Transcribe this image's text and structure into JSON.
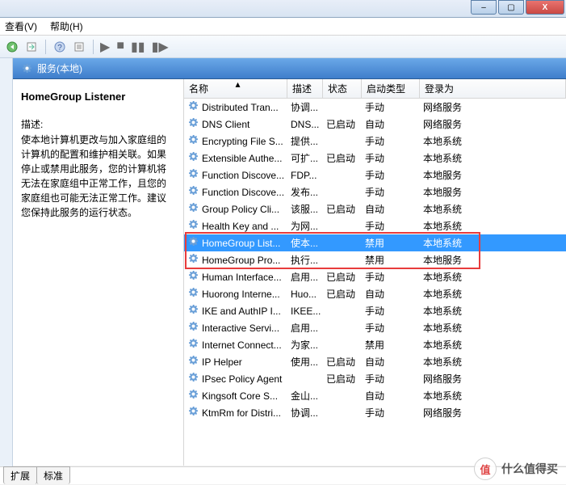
{
  "window": {
    "min": "–",
    "max": "▢",
    "close": "X"
  },
  "menu": {
    "view": "查看(V)",
    "help": "帮助(H)"
  },
  "nav": {
    "label": "服务(本地)"
  },
  "info": {
    "title": "HomeGroup Listener",
    "desc_label": "描述:",
    "description": "使本地计算机更改与加入家庭组的计算机的配置和维护相关联。如果停止或禁用此服务，您的计算机将无法在家庭组中正常工作，且您的家庭组也可能无法正常工作。建议您保持此服务的运行状态。"
  },
  "columns": {
    "name": "名称",
    "desc": "描述",
    "state": "状态",
    "start": "启动类型",
    "login": "登录为"
  },
  "services": [
    {
      "name": "Distributed Tran...",
      "desc": "协调...",
      "state": "",
      "start": "手动",
      "login": "网络服务"
    },
    {
      "name": "DNS Client",
      "desc": "DNS...",
      "state": "已启动",
      "start": "自动",
      "login": "网络服务"
    },
    {
      "name": "Encrypting File S...",
      "desc": "提供...",
      "state": "",
      "start": "手动",
      "login": "本地系统"
    },
    {
      "name": "Extensible Authe...",
      "desc": "可扩...",
      "state": "已启动",
      "start": "手动",
      "login": "本地系统"
    },
    {
      "name": "Function Discove...",
      "desc": "FDP...",
      "state": "",
      "start": "手动",
      "login": "本地服务"
    },
    {
      "name": "Function Discove...",
      "desc": "发布...",
      "state": "",
      "start": "手动",
      "login": "本地服务"
    },
    {
      "name": "Group Policy Cli...",
      "desc": "该服...",
      "state": "已启动",
      "start": "自动",
      "login": "本地系统"
    },
    {
      "name": "Health Key and ...",
      "desc": "为网...",
      "state": "",
      "start": "手动",
      "login": "本地系统"
    },
    {
      "name": "HomeGroup List...",
      "desc": "使本...",
      "state": "",
      "start": "禁用",
      "login": "本地系统",
      "selected": true
    },
    {
      "name": "HomeGroup Pro...",
      "desc": "执行...",
      "state": "",
      "start": "禁用",
      "login": "本地服务"
    },
    {
      "name": "Human Interface...",
      "desc": "启用...",
      "state": "已启动",
      "start": "手动",
      "login": "本地系统"
    },
    {
      "name": "Huorong Interne...",
      "desc": "Huo...",
      "state": "已启动",
      "start": "自动",
      "login": "本地系统"
    },
    {
      "name": "IKE and AuthIP I...",
      "desc": "IKEE...",
      "state": "",
      "start": "手动",
      "login": "本地系统"
    },
    {
      "name": "Interactive Servi...",
      "desc": "启用...",
      "state": "",
      "start": "手动",
      "login": "本地系统"
    },
    {
      "name": "Internet Connect...",
      "desc": "为家...",
      "state": "",
      "start": "禁用",
      "login": "本地系统"
    },
    {
      "name": "IP Helper",
      "desc": "使用...",
      "state": "已启动",
      "start": "自动",
      "login": "本地系统"
    },
    {
      "name": "IPsec Policy Agent",
      "desc": "",
      "state": "已启动",
      "start": "手动",
      "login": "网络服务"
    },
    {
      "name": "Kingsoft Core S...",
      "desc": "金山...",
      "state": "",
      "start": "自动",
      "login": "本地系统"
    },
    {
      "name": "KtmRm for Distri...",
      "desc": "协调...",
      "state": "",
      "start": "手动",
      "login": "网络服务"
    }
  ],
  "tabs": {
    "ext": "扩展",
    "std": "标准"
  },
  "watermark": {
    "icon": "值",
    "text": "什么值得买"
  }
}
